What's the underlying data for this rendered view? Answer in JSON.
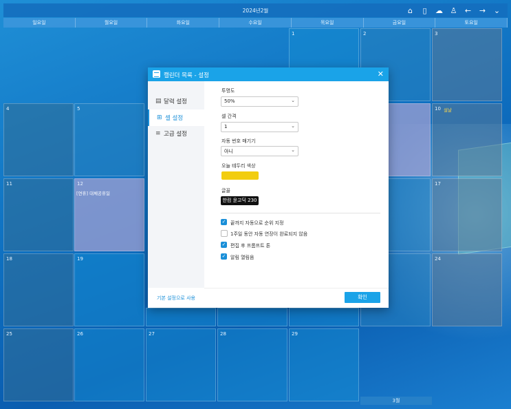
{
  "calendar": {
    "title": "2024년2월",
    "weekdays": [
      "일요일",
      "월요일",
      "화요일",
      "수요일",
      "목요일",
      "금요일",
      "토요일"
    ],
    "cells": [
      {
        "num": "1"
      },
      {
        "num": "2"
      },
      {
        "num": "3"
      },
      {
        "num": "4"
      },
      {
        "num": "5"
      },
      {
        "num": "10",
        "event": "설날"
      },
      {
        "num": "11"
      },
      {
        "num": "12",
        "event": "[연휴] 대체공휴일"
      },
      {
        "num": "17"
      },
      {
        "num": "18"
      },
      {
        "num": "19"
      },
      {
        "num": "24"
      },
      {
        "num": "25"
      },
      {
        "num": "26"
      },
      {
        "num": "27"
      },
      {
        "num": "28"
      },
      {
        "num": "29"
      }
    ],
    "next_month": "3월",
    "top_icons": [
      "home-icon",
      "phone-icon",
      "cloud-sync-icon",
      "user-icon",
      "arrow-left-icon",
      "arrow-right-icon",
      "chevron-down-icon"
    ]
  },
  "dialog": {
    "title": "캘린더 목록 - 설정",
    "sidebar": [
      {
        "icon": "calendar-icon",
        "label": "달력 설정"
      },
      {
        "icon": "grid-icon",
        "label": "셀 설정"
      },
      {
        "icon": "sliders-icon",
        "label": "고급 설정"
      }
    ],
    "transparency": {
      "label": "투명도",
      "value": "50%"
    },
    "cell_spacing": {
      "label": "셀 간격",
      "value": "1"
    },
    "auto_number": {
      "label": "자동 번호 매기기",
      "value": "아니"
    },
    "today_border": {
      "label": "오늘 테두리 색상",
      "color": "#f2cd10"
    },
    "font": {
      "label": "글꼴",
      "value": "한컴 윤고딕 230"
    },
    "checkboxes": [
      {
        "label": "끝까지 자동으로 순위 지정",
        "checked": true
      },
      {
        "label": "1주일 동안 자동 연장이 완료되지 않음",
        "checked": false
      },
      {
        "label": "편집 후 프롬프트 톤",
        "checked": true
      },
      {
        "label": "알림 열림음",
        "checked": true
      }
    ],
    "reset_label": "기본 설정으로 사용",
    "ok_label": "확인"
  }
}
